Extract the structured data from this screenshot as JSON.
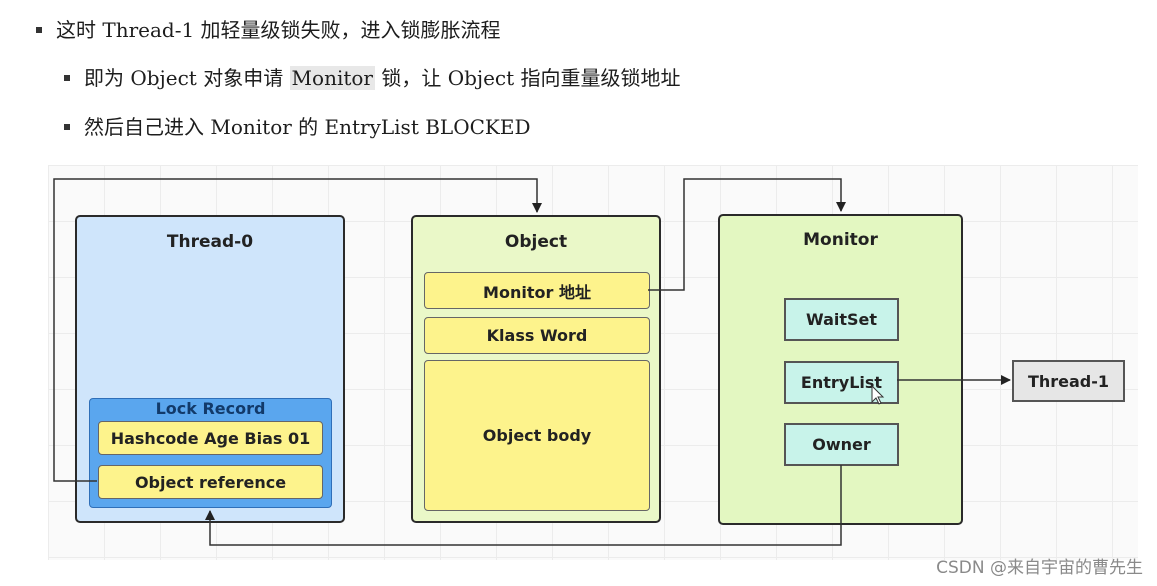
{
  "bullets": [
    {
      "level": 1,
      "text": "这时 Thread-1 加轻量级锁失败，进入锁膨胀流程"
    },
    {
      "level": 2,
      "text_before": "即为 Object 对象申请 ",
      "highlight": "Monitor",
      "text_after": " 锁，让 Object 指向重量级锁地址"
    },
    {
      "level": 2,
      "text": "然后自己进入 Monitor 的 EntryList BLOCKED"
    }
  ],
  "diagram": {
    "thread0": {
      "title": "Thread-0",
      "lock_record": {
        "title": "Lock Record",
        "fields": [
          "Hashcode Age Bias 01",
          "Object reference"
        ]
      }
    },
    "object": {
      "title": "Object",
      "fields": [
        "Monitor 地址",
        "Klass Word",
        "Object body"
      ]
    },
    "monitor": {
      "title": "Monitor",
      "fields": [
        "WaitSet",
        "EntryList",
        "Owner"
      ]
    },
    "thread1": {
      "title": "Thread-1"
    },
    "colors": {
      "thread_bg": "#cfe5fb",
      "lock_record_bg": "#5aa6ee",
      "object_bg": "#eaf8c8",
      "monitor_bg": "#e3f7c1",
      "field_bg": "#fdf38c",
      "monitor_field_bg": "#c8f3ea",
      "thread1_bg": "#e6e6e6"
    }
  },
  "watermark": "CSDN @来自宇宙的曹先生"
}
